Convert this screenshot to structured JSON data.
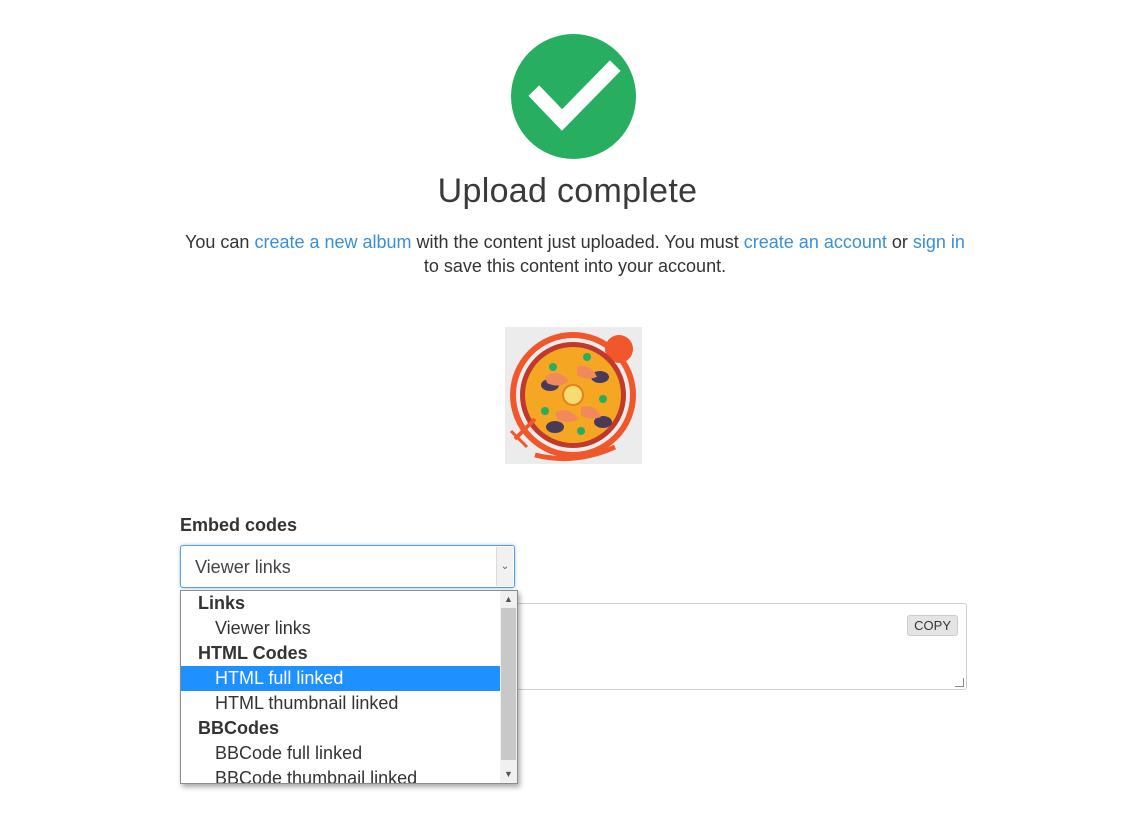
{
  "status": {
    "title": "Upload complete",
    "icon": "checkmark-circle-icon",
    "color": "#27ae60"
  },
  "message": {
    "part1": "You can ",
    "link_album": "create a new album",
    "part2": " with the content just uploaded. You must ",
    "link_account": "create an account",
    "part3": " or ",
    "link_signin": "sign in",
    "part4": " to save this content into your account.",
    "link_color": "#3b8fd3"
  },
  "embed": {
    "label": "Embed codes",
    "selected_value": "Viewer links",
    "copy_label": "COPY",
    "groups": [
      {
        "label": "Links",
        "options": [
          "Viewer links"
        ]
      },
      {
        "label": "HTML Codes",
        "options": [
          "HTML full linked",
          "HTML thumbnail linked"
        ]
      },
      {
        "label": "BBCodes",
        "options": [
          "BBCode full linked",
          "BBCode thumbnail linked"
        ]
      }
    ],
    "highlighted_option": "HTML full linked",
    "highlight_color": "#1e90ff"
  }
}
